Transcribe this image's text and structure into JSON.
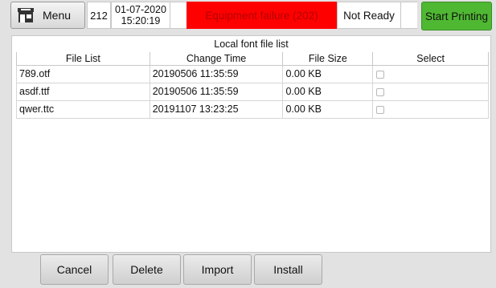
{
  "header": {
    "menu_label": "Menu",
    "menu_icon": "home-icon",
    "counter": "212",
    "date": "01-07-2020",
    "time": "15:20:19",
    "alarm_text": "Equipment failure (202)",
    "status_text": "Not Ready",
    "start_label": "Start Printing",
    "colors": {
      "alarm_bg": "#ff0000",
      "alarm_text": "#b40000",
      "start_bg": "#4fb832"
    }
  },
  "panel": {
    "title": "Local font file list",
    "columns": [
      "File List",
      "Change Time",
      "File Size",
      "Select"
    ],
    "rows": [
      {
        "name": "789.otf",
        "time": "20190506 11:35:59",
        "size": "0.00 KB",
        "selected": false
      },
      {
        "name": "asdf.ttf",
        "time": "20190506 11:35:59",
        "size": "0.00 KB",
        "selected": false
      },
      {
        "name": "qwer.ttc",
        "time": "20191107 13:23:25",
        "size": "0.00 KB",
        "selected": false
      }
    ]
  },
  "footer": {
    "cancel_label": "Cancel",
    "delete_label": "Delete",
    "import_label": "Import",
    "install_label": "Install"
  }
}
